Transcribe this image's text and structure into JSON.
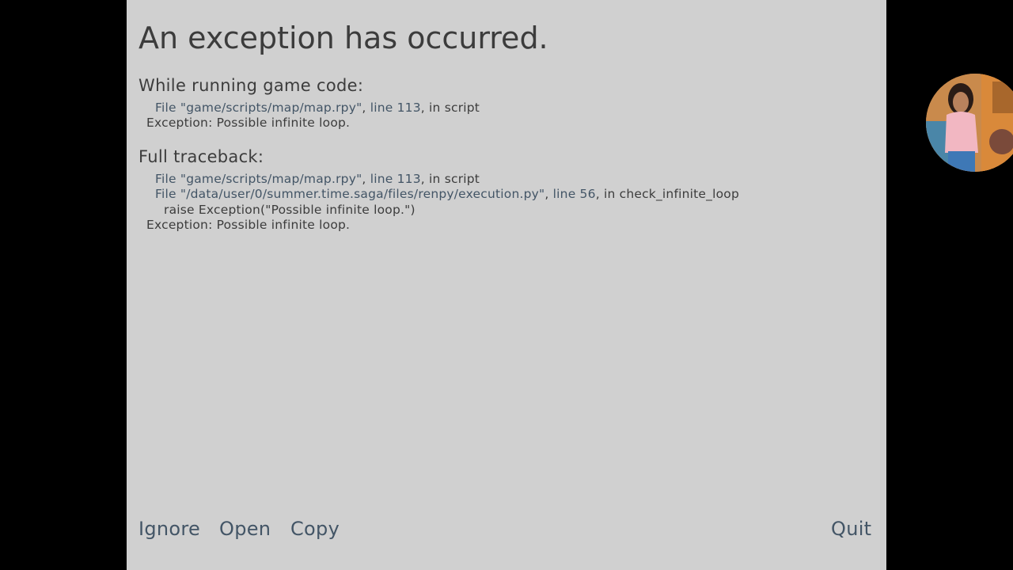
{
  "title": "An exception has occurred.",
  "game_code": {
    "heading": "While running game code:",
    "lines": [
      {
        "file_link": "File \"game/scripts/map/map.rpy\"",
        "sep": ", ",
        "line_link": "line 113",
        "rest": ", in script"
      }
    ],
    "exception": "Exception: Possible infinite loop."
  },
  "traceback": {
    "heading": "Full traceback:",
    "lines": [
      {
        "file_link": "File \"game/scripts/map/map.rpy\"",
        "sep": ", ",
        "line_link": "line 113",
        "rest": ", in script"
      },
      {
        "file_link": "File \"/data/user/0/summer.time.saga/files/renpy/execution.py\"",
        "sep": ", ",
        "line_link": "line 56",
        "rest": ", in check_infinite_loop"
      }
    ],
    "code_line": "raise Exception(\"Possible infinite loop.\")",
    "exception": "Exception: Possible infinite loop."
  },
  "footer": {
    "ignore_label": "Ignore",
    "open_label": "Open",
    "copy_label": "Copy",
    "quit_label": "Quit"
  },
  "colors": {
    "panel_background": "#d0d0d0",
    "outer_background": "#000000",
    "text": "#3c3c3c",
    "link": "#435566"
  },
  "overlay": {
    "icon": "profile-avatar-icon"
  }
}
